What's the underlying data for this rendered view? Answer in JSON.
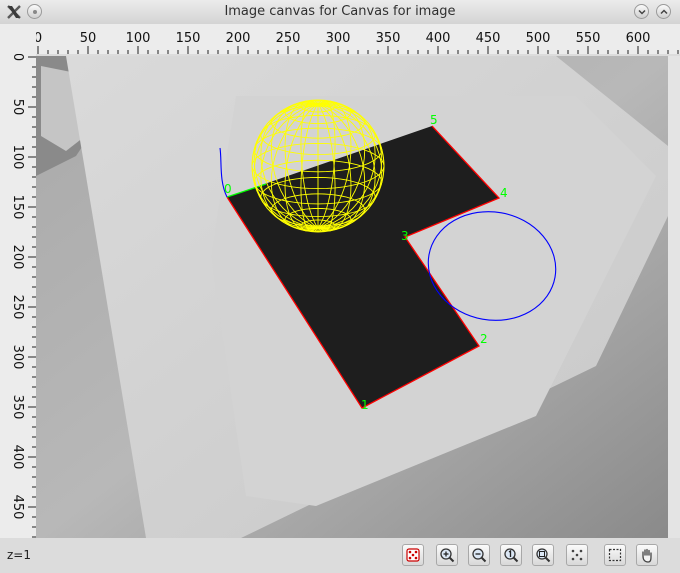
{
  "window": {
    "title": "Image canvas for Canvas for image"
  },
  "ruler_top": {
    "labels": [
      "0",
      "50",
      "100",
      "150",
      "200",
      "250",
      "300",
      "350",
      "400",
      "450",
      "500",
      "550",
      "600"
    ]
  },
  "ruler_left": {
    "labels": [
      "0",
      "50",
      "100",
      "150",
      "200",
      "250",
      "300",
      "350",
      "400",
      "450"
    ]
  },
  "overlay": {
    "point_labels": [
      "0",
      "1",
      "2",
      "3",
      "4",
      "5"
    ],
    "colors": {
      "polygon_edge": "#ff0000",
      "label": "#00ff00",
      "sphere": "#ffff00",
      "ellipse": "#0000ff",
      "curve": "#0000ff"
    }
  },
  "status": {
    "zoom_text": "z=1"
  },
  "toolbar": {
    "tools": [
      {
        "name": "random-color-tool",
        "icon": "dice-red-icon"
      },
      {
        "name": "zoom-in-tool",
        "icon": "zoom-in-icon"
      },
      {
        "name": "zoom-out-tool",
        "icon": "zoom-out-icon"
      },
      {
        "name": "zoom-reset-tool",
        "icon": "zoom-one-icon"
      },
      {
        "name": "zoom-fit-tool",
        "icon": "zoom-fit-icon"
      },
      {
        "name": "dots-tool",
        "icon": "dice-gray-icon"
      },
      {
        "name": "select-tool",
        "icon": "select-rect-icon"
      },
      {
        "name": "pan-tool",
        "icon": "hand-icon"
      }
    ]
  }
}
